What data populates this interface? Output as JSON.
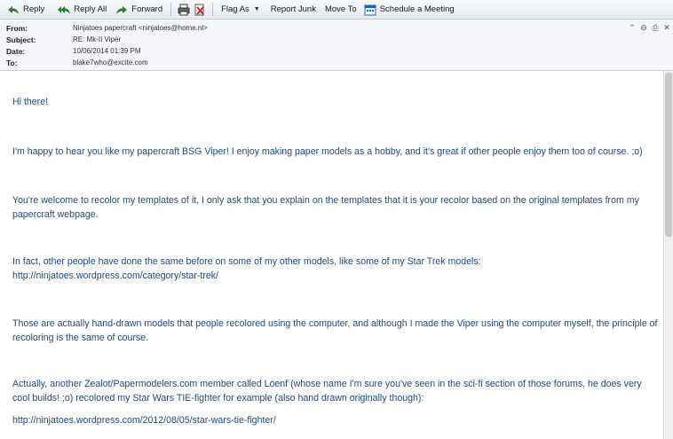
{
  "toolbar": {
    "reply": "Reply",
    "reply_all": "Reply All",
    "forward": "Forward",
    "flag_as": "Flag As",
    "report_junk": "Report Junk",
    "move_to": "Move To",
    "schedule_meeting": "Schedule a Meeting",
    "icons": {
      "reply": "reply-icon",
      "reply_all": "reply-all-icon",
      "forward": "forward-icon",
      "print": "printer-icon",
      "delete": "delete-icon",
      "calendar": "calendar-icon"
    },
    "accent_color": "#2e7d32"
  },
  "header": {
    "from_label": "From:",
    "from_value": "Ninjatoes papercraft <ninjatoes@home.nl>",
    "subject_label": "Subject:",
    "subject_value": "RE: Mk-II Viper",
    "date_label": "Date:",
    "date_value": "10/06/2014 01:39 PM",
    "to_label": "To:",
    "to_value": "blake7who@excite.com",
    "icons": [
      "collapse-icon",
      "lock-icon",
      "print-icon",
      "close-icon"
    ]
  },
  "message": {
    "text_color": "#1f497d",
    "paragraphs": [
      "Hi there!",
      "I'm happy to hear you like my papercraft BSG Viper! I enjoy making paper models as a hobby, and it's great if other people enjoy them too of course. ;o)",
      "You're welcome to recolor my templates of it, I only ask that you explain on the templates that it is your recolor based on the original templates from my papercraft webpage.",
      "In fact, other people have done the same before on some of my other models, like some of my Star Trek models:\nhttp://ninjatoes.wordpress.com/category/star-trek/",
      "Those are actually hand-drawn models that people recolored using the computer, and although I made the Viper using the computer myself, the principle of recoloring is the same of course.",
      "Actually, another Zealot/Papermodelers.com member called Loenf (whose name I'm sure you've seen in the sci-fi section of those forums, he does very cool builds! ;o) recolored my Star Wars TIE-fighter for example (also hand drawn originally though):",
      "http://ninjatoes.wordpress.com/2012/08/05/star-wars-tie-fighter/"
    ]
  }
}
